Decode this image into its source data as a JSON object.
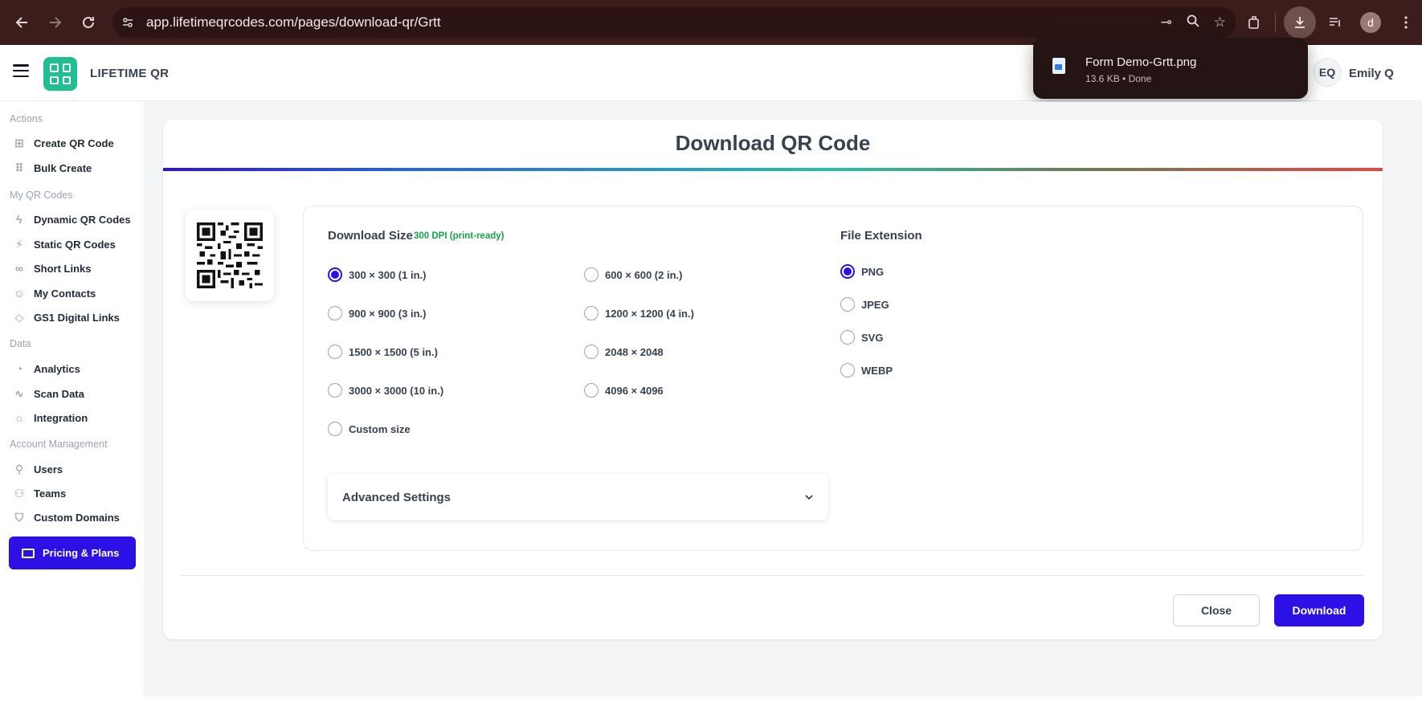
{
  "browser": {
    "url": "app.lifetimeqrcodes.com/pages/download-qr/Grtt",
    "profile_initial": "d",
    "icons": [
      "back-icon",
      "forward-icon",
      "reload-icon",
      "site-info-icon",
      "cast-icon",
      "zoom-icon",
      "bookmark-star-icon",
      "extensions-icon",
      "download-icon",
      "reading-list-icon",
      "profile-avatar"
    ]
  },
  "download_popup": {
    "file_name": "Form Demo-Grtt.png",
    "meta": "13.6 KB • Done"
  },
  "header": {
    "brand": "LIFETIME QR",
    "user_initials": "EQ",
    "user_name": "Emily Q"
  },
  "sidebar": {
    "sections": {
      "actions": "Actions",
      "my_qr": "My QR Codes",
      "data": "Data",
      "account": "Account Management"
    },
    "items": [
      {
        "label": "Create QR Code",
        "icon": "plus-square-icon"
      },
      {
        "label": "Bulk Create",
        "icon": "grid-icon"
      },
      {
        "label": "Dynamic QR Codes",
        "icon": "bolt-icon"
      },
      {
        "label": "Static QR Codes",
        "icon": "bolt-off-icon"
      },
      {
        "label": "Short Links",
        "icon": "link-icon"
      },
      {
        "label": "My Contacts",
        "icon": "contacts-icon"
      },
      {
        "label": "GS1 Digital Links",
        "icon": "tag-icon"
      },
      {
        "label": "Analytics",
        "icon": "pie-chart-icon"
      },
      {
        "label": "Scan Data",
        "icon": "activity-icon"
      },
      {
        "label": "Integration",
        "icon": "bulb-icon"
      },
      {
        "label": "Users",
        "icon": "user-plus-icon"
      },
      {
        "label": "Teams",
        "icon": "users-icon"
      },
      {
        "label": "Custom Domains",
        "icon": "shield-icon"
      }
    ],
    "pricing": "Pricing & Plans"
  },
  "dialog": {
    "title": "Download QR Code",
    "size_heading": "Download Size",
    "dpi_note": "300 DPI (print-ready)",
    "sizes": [
      {
        "label": "300 × 300 (1 in.)",
        "selected": true
      },
      {
        "label": "600 × 600 (2 in.)",
        "selected": false
      },
      {
        "label": "900 × 900 (3 in.)",
        "selected": false
      },
      {
        "label": "1200 × 1200 (4 in.)",
        "selected": false
      },
      {
        "label": "1500 × 1500 (5 in.)",
        "selected": false
      },
      {
        "label": "2048 × 2048",
        "selected": false
      },
      {
        "label": "3000 × 3000 (10 in.)",
        "selected": false
      },
      {
        "label": "4096 × 4096",
        "selected": false
      },
      {
        "label": "Custom size",
        "selected": false
      }
    ],
    "ext_heading": "File Extension",
    "extensions": [
      {
        "label": "PNG",
        "selected": true
      },
      {
        "label": "JPEG",
        "selected": false
      },
      {
        "label": "SVG",
        "selected": false
      },
      {
        "label": "WEBP",
        "selected": false
      }
    ],
    "advanced": "Advanced Settings",
    "close": "Close",
    "download": "Download"
  },
  "colors": {
    "accent": "#2b11e6",
    "brand_green": "#1fbf8f",
    "dpi_green": "#16a34a",
    "chrome_bg": "#3b1d1b"
  }
}
